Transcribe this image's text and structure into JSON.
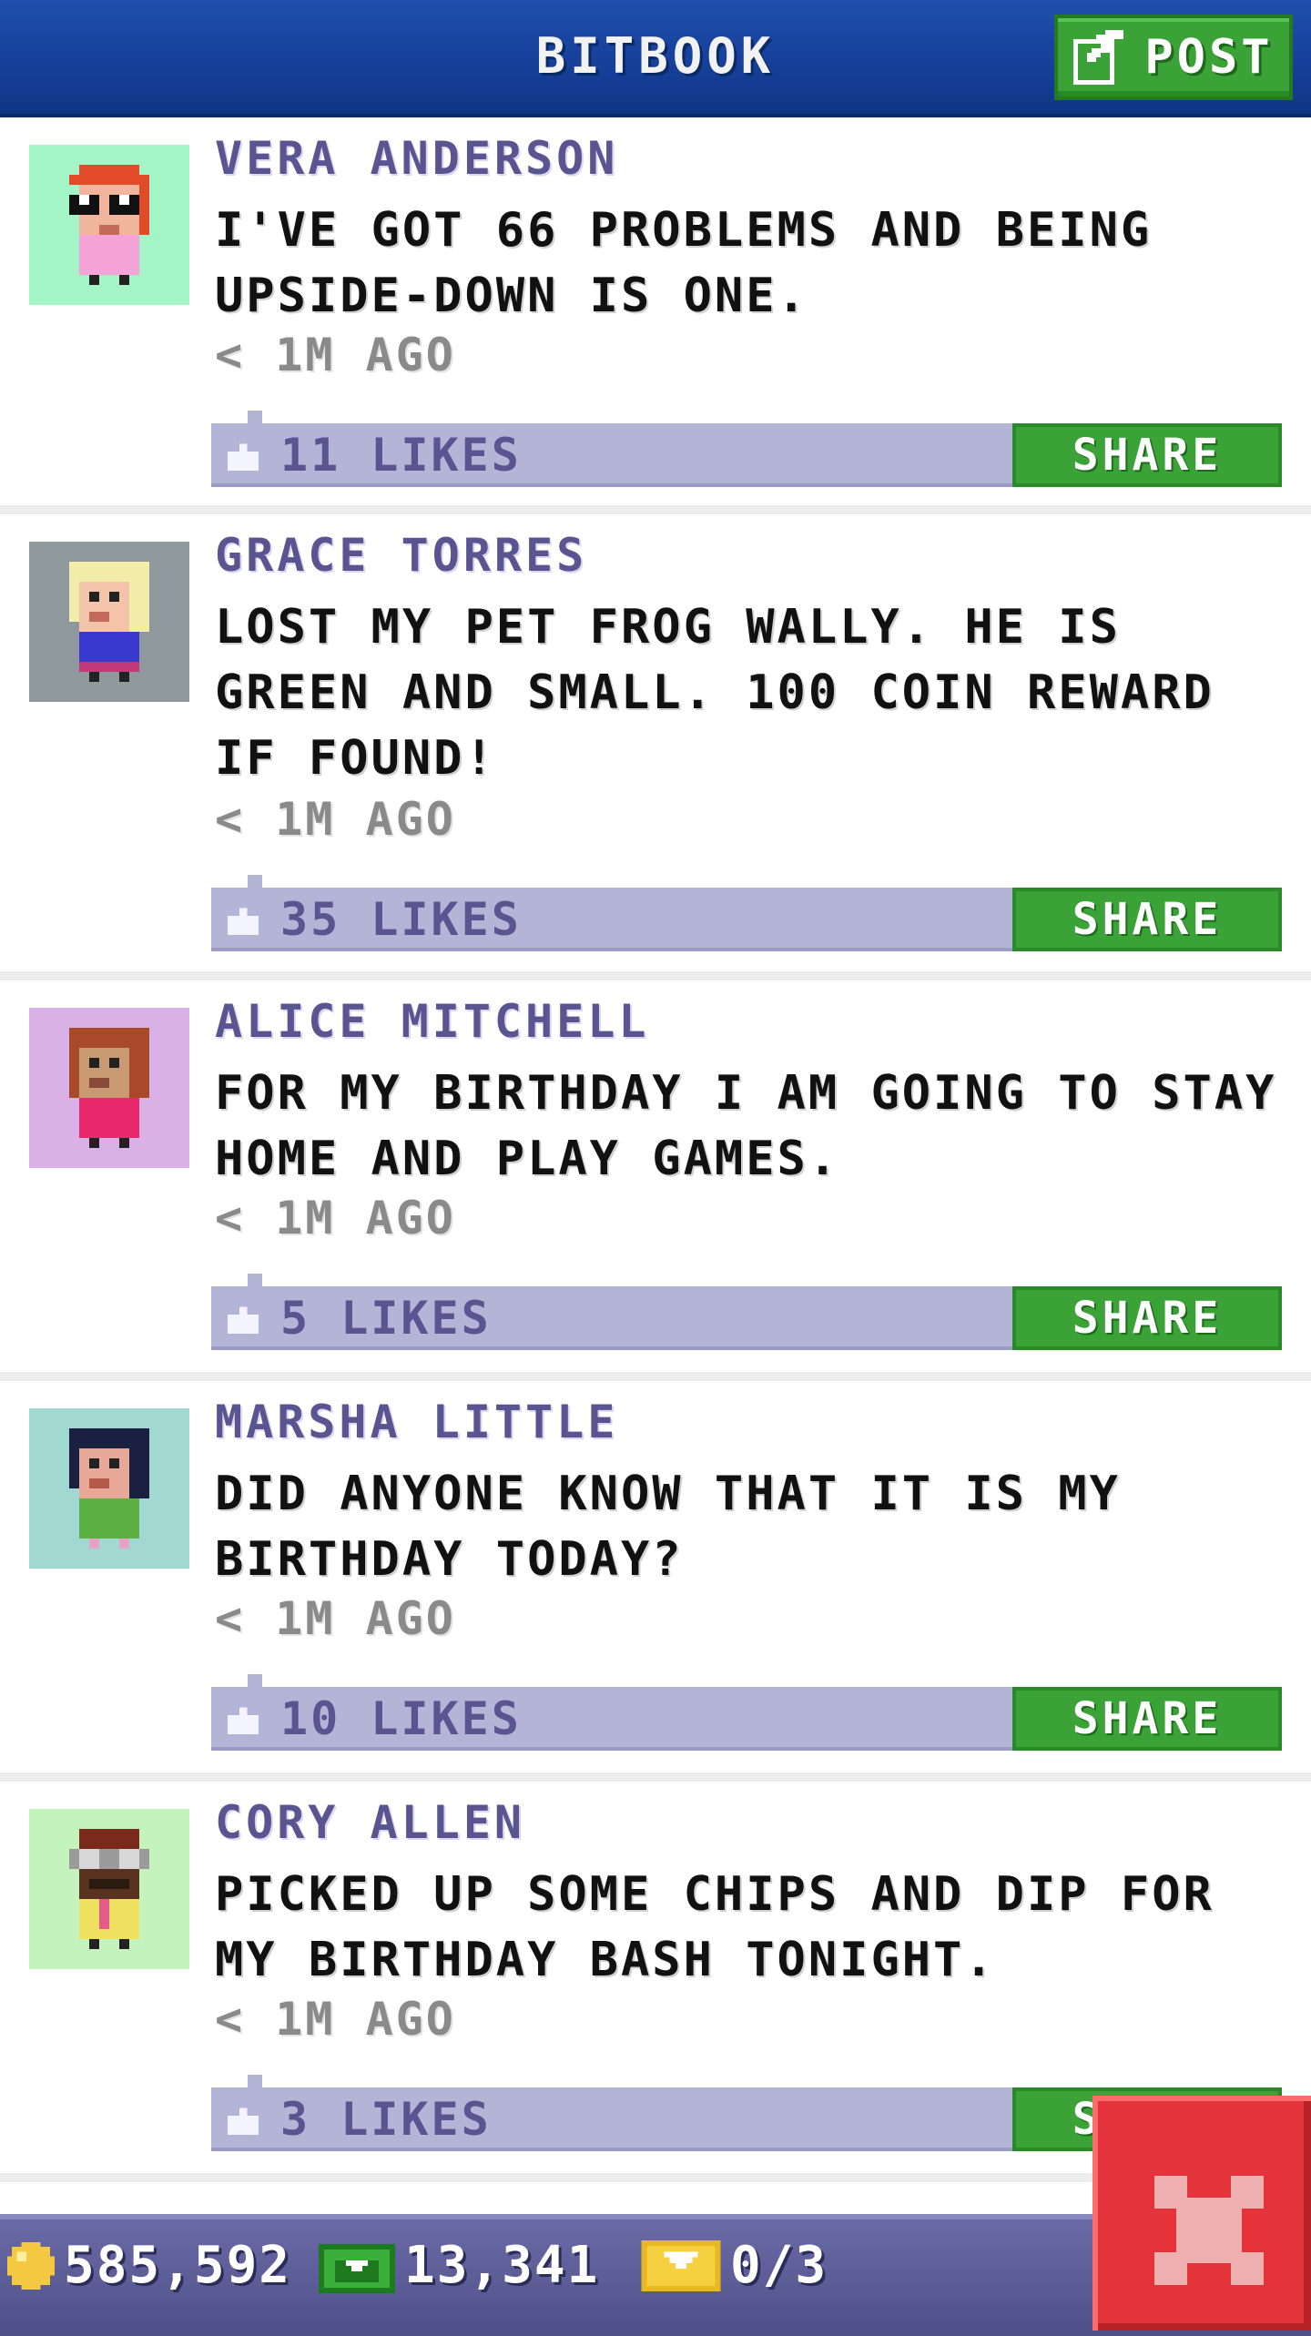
{
  "header": {
    "title": "BITBOOK",
    "post_label": "POST"
  },
  "posts": [
    {
      "author": "VERA ANDERSON",
      "message": "I'VE GOT 66 PROBLEMS AND BEING UPSIDE-DOWN IS ONE.",
      "time": "< 1M AGO",
      "likes": "11 LIKES",
      "share": "SHARE",
      "avatar_bg": "#a3f5c8"
    },
    {
      "author": "GRACE TORRES",
      "message": "LOST MY PET FROG WALLY. HE IS GREEN AND SMALL. 100 COIN REWARD IF FOUND!",
      "time": "< 1M AGO",
      "likes": "35 LIKES",
      "share": "SHARE",
      "avatar_bg": "#8f989c"
    },
    {
      "author": "ALICE MITCHELL",
      "message": "FOR MY BIRTHDAY I AM GOING TO STAY HOME AND PLAY GAMES.",
      "time": "< 1M AGO",
      "likes": "5 LIKES",
      "share": "SHARE",
      "avatar_bg": "#d9b1e6"
    },
    {
      "author": "MARSHA LITTLE",
      "message": "DID ANYONE KNOW THAT IT IS MY BIRTHDAY TODAY?",
      "time": "< 1M AGO",
      "likes": "10 LIKES",
      "share": "SHARE",
      "avatar_bg": "#a2d8d2"
    },
    {
      "author": "CORY ALLEN",
      "message": "PICKED UP SOME CHIPS AND DIP FOR MY BIRTHDAY BASH TONIGHT.",
      "time": "< 1M AGO",
      "likes": "3 LIKES",
      "share": "SHARE",
      "avatar_bg": "#c5f3bd"
    }
  ],
  "status_bar": {
    "coins": "585,592",
    "bux": "13,341",
    "tickets": "0/3"
  },
  "colors": {
    "header": "#16409a",
    "accent_green": "#3aa236",
    "likes_bar": "#b4b4d6",
    "author_text": "#5a5590",
    "close_red": "#e4333a"
  },
  "icons": [
    "post-edit-icon",
    "thumbs-up-icon",
    "coin-icon",
    "bux-icon",
    "ticket-icon",
    "close-icon"
  ]
}
